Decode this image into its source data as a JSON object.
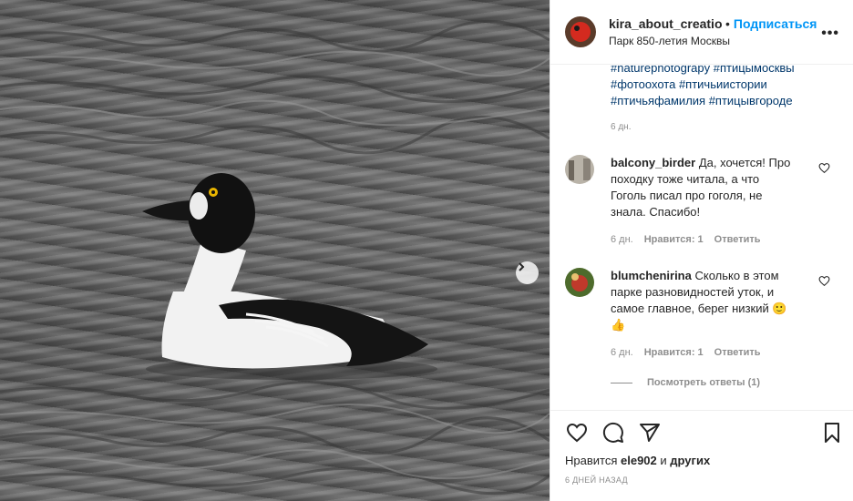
{
  "header": {
    "username": "kira_about_creation",
    "separator": "•",
    "follow_label": "Подписаться",
    "location": "Парк 850-летия Москвы",
    "more_label": "•••"
  },
  "caption": {
    "tags_line1": "#naturephotograpy #птицымосквы",
    "tags_line2": "#фотоохота #птичьиистории",
    "tags_line3": "#птичьяфамилия #птицывгороде",
    "time": "6 дн."
  },
  "comments": [
    {
      "username": "balcony_birder",
      "text": "Да, хочется! Про походку тоже читала, а что Гоголь писал про гоголя, не знала. Спасибо!",
      "time": "6 дн.",
      "likes": "Нравится: 1",
      "reply": "Ответить"
    },
    {
      "username": "blumchenirina",
      "text": "Сколько в этом парке разновидностей уток, и самое главное, берег низкий 🙂 👍",
      "time": "6 дн.",
      "likes": "Нравится: 1",
      "reply": "Ответить"
    }
  ],
  "view_replies": "Посмотреть ответы (1)",
  "footer": {
    "likes_prefix": "Нравится",
    "liker": "ele902",
    "likes_and": "и",
    "likes_others": "других",
    "post_time": "6 дней назад"
  },
  "icons": [
    "heart-icon",
    "comment-icon",
    "share-icon",
    "bookmark-icon",
    "chevron-right-icon",
    "more-icon"
  ],
  "colors": {
    "link_blue": "#0095f6",
    "hashtag": "#00376b",
    "muted": "#8e8e8e",
    "text": "#262626"
  }
}
